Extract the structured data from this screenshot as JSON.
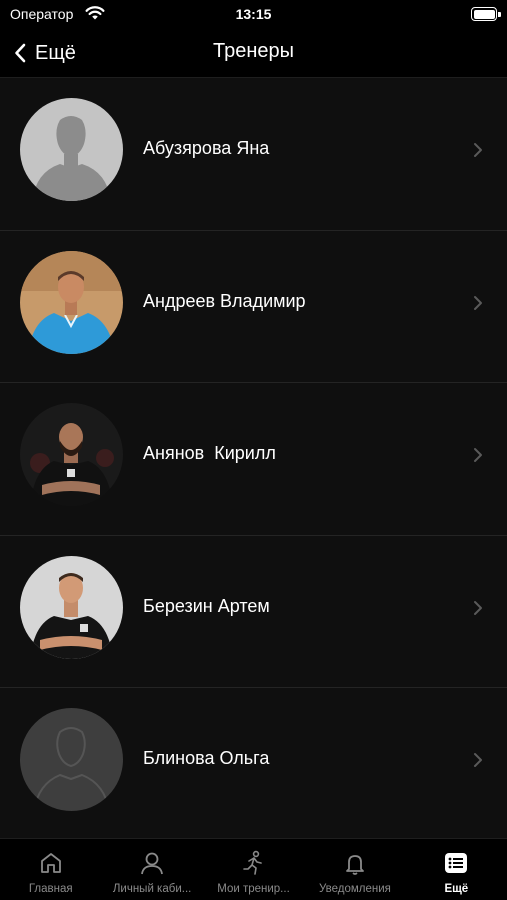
{
  "status_bar": {
    "carrier": "Оператор",
    "time": "13:15"
  },
  "nav": {
    "back_label": "Ещё",
    "title": "Тренеры"
  },
  "trainers": [
    {
      "name": "Абузярова Яна",
      "avatar": "placeholder-silhouette"
    },
    {
      "name": "Андреев Владимир",
      "avatar": "photo-blue-tracksuit"
    },
    {
      "name": "Анянов  Кирилл",
      "avatar": "photo-black-polo-beard"
    },
    {
      "name": "Березин Артем",
      "avatar": "photo-black-polo"
    },
    {
      "name": "Блинова Ольга",
      "avatar": "placeholder-outline"
    }
  ],
  "tabs": [
    {
      "label": "Главная",
      "icon": "home-icon"
    },
    {
      "label": "Личный каби...",
      "icon": "user-icon"
    },
    {
      "label": "Мои тренир...",
      "icon": "running-icon"
    },
    {
      "label": "Уведомления",
      "icon": "bell-icon"
    },
    {
      "label": "Ещё",
      "icon": "list-icon",
      "active": true
    }
  ],
  "colors": {
    "background": "#0f0f0f",
    "text": "#ffffff",
    "inactive_tab": "#8a8a8a",
    "chevron": "#5a5a5a"
  }
}
